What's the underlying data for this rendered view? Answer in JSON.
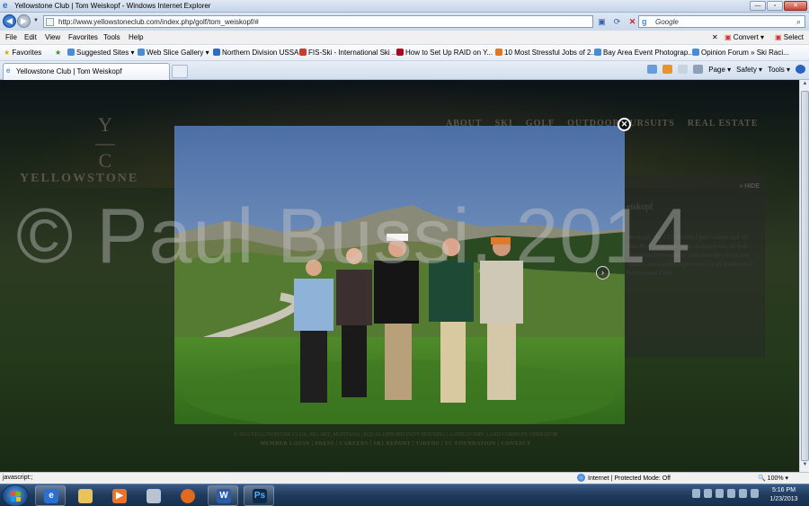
{
  "window": {
    "title": "Yellowstone Club | Tom Weiskopf - Windows Internet Explorer"
  },
  "address_bar": {
    "url": "http://www.yellowstoneclub.com/index.php/golf/tom_weiskopf/#",
    "search_placeholder": "Google"
  },
  "menu": {
    "items": [
      "File",
      "Edit",
      "View",
      "Favorites",
      "Tools",
      "Help"
    ],
    "convert_label": "Convert",
    "select_label": "Select"
  },
  "favorites_bar": {
    "favorites_label": "Favorites",
    "items": [
      "Suggested Sites ▾",
      "Web Slice Gallery ▾",
      "Northern Division USSA",
      "FIS-Ski - International Ski ...",
      "How to Set Up RAID on Y...",
      "10 Most Stressful Jobs of 2...",
      "Bay Area Event Photograp...",
      "Opinion Forum » Ski Raci..."
    ]
  },
  "tabs": [
    {
      "label": "Yellowstone Club | Tom Weiskopf"
    }
  ],
  "command_bar": {
    "page_label": "Page ▾",
    "safety_label": "Safety ▾",
    "tools_label": "Tools ▾"
  },
  "site": {
    "logo_text": "YELLOWSTONE",
    "nav": [
      "ABOUT",
      "SKI",
      "GOLF",
      "OUTDOOR PURSUITS",
      "REAL ESTATE"
    ],
    "hide_label": "» HIDE",
    "panel_heading": "eiskopf",
    "panel_body": "Weiskopf, the 1973 British Open winner and 16-time PGA Tour champion, designed this 18-hole championship course to maximize the views and create a memorable experience for all members of Yellowstone Club.",
    "footer_line": "© 2012 YELLOWSTONE CLUB, BIG SKY, MONTANA | EQUAL OPPORTUNITY HOUSING | A DISCOVERY LAND COMPANY OPERATOR",
    "footer_links": [
      "MEMBER LOGIN",
      "PRESS",
      "CAREERS",
      "SKI REPORT",
      "VIDEOS",
      "YC FOUNDATION",
      "CONTACT"
    ]
  },
  "lightbox": {
    "close_icon": "✕",
    "next_icon": "›"
  },
  "watermark": "© Paul Bussi, 2014",
  "status_bar": {
    "status_text": "javascript:;",
    "zone_text": "Internet | Protected Mode: Off",
    "zoom_text": "100%"
  },
  "taskbar": {
    "time": "5:16 PM",
    "date": "1/23/2013"
  }
}
